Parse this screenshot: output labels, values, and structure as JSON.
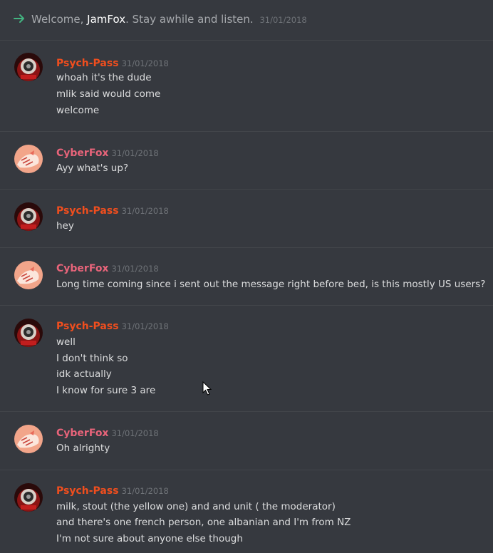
{
  "system": {
    "prefix": "Welcome, ",
    "user": "JamFox",
    "suffix": ". Stay awhile and listen.",
    "timestamp": "31/01/2018"
  },
  "colors": {
    "background": "#36393f",
    "psych_pass_name": "#f04e1e",
    "cyberfox_name": "#e8647a",
    "arrow": "#43b581"
  },
  "messages": [
    {
      "author": "Psych-Pass",
      "avatar": "psych-pass-avatar",
      "timestamp": "31/01/2018",
      "lines": [
        "whoah it's the dude",
        "mlik said would come",
        "welcome"
      ]
    },
    {
      "author": "CyberFox",
      "avatar": "cyberfox-avatar",
      "timestamp": "31/01/2018",
      "lines": [
        "Ayy what's up?"
      ]
    },
    {
      "author": "Psych-Pass",
      "avatar": "psych-pass-avatar",
      "timestamp": "31/01/2018",
      "lines": [
        "hey"
      ]
    },
    {
      "author": "CyberFox",
      "avatar": "cyberfox-avatar",
      "timestamp": "31/01/2018",
      "lines": [
        "Long time coming since i sent out the message right before bed, is this mostly US users?"
      ]
    },
    {
      "author": "Psych-Pass",
      "avatar": "psych-pass-avatar",
      "timestamp": "31/01/2018",
      "lines": [
        "well",
        "I don't think so",
        "idk actually",
        "I know for sure 3 are"
      ]
    },
    {
      "author": "CyberFox",
      "avatar": "cyberfox-avatar",
      "timestamp": "31/01/2018",
      "lines": [
        "Oh alrighty"
      ]
    },
    {
      "author": "Psych-Pass",
      "avatar": "psych-pass-avatar",
      "timestamp": "31/01/2018",
      "lines": [
        "milk, stout (the yellow one) and and unit ( the moderator)",
        "and there's one french person, one albanian and I'm from NZ",
        "I'm not sure about anyone else though"
      ]
    }
  ]
}
